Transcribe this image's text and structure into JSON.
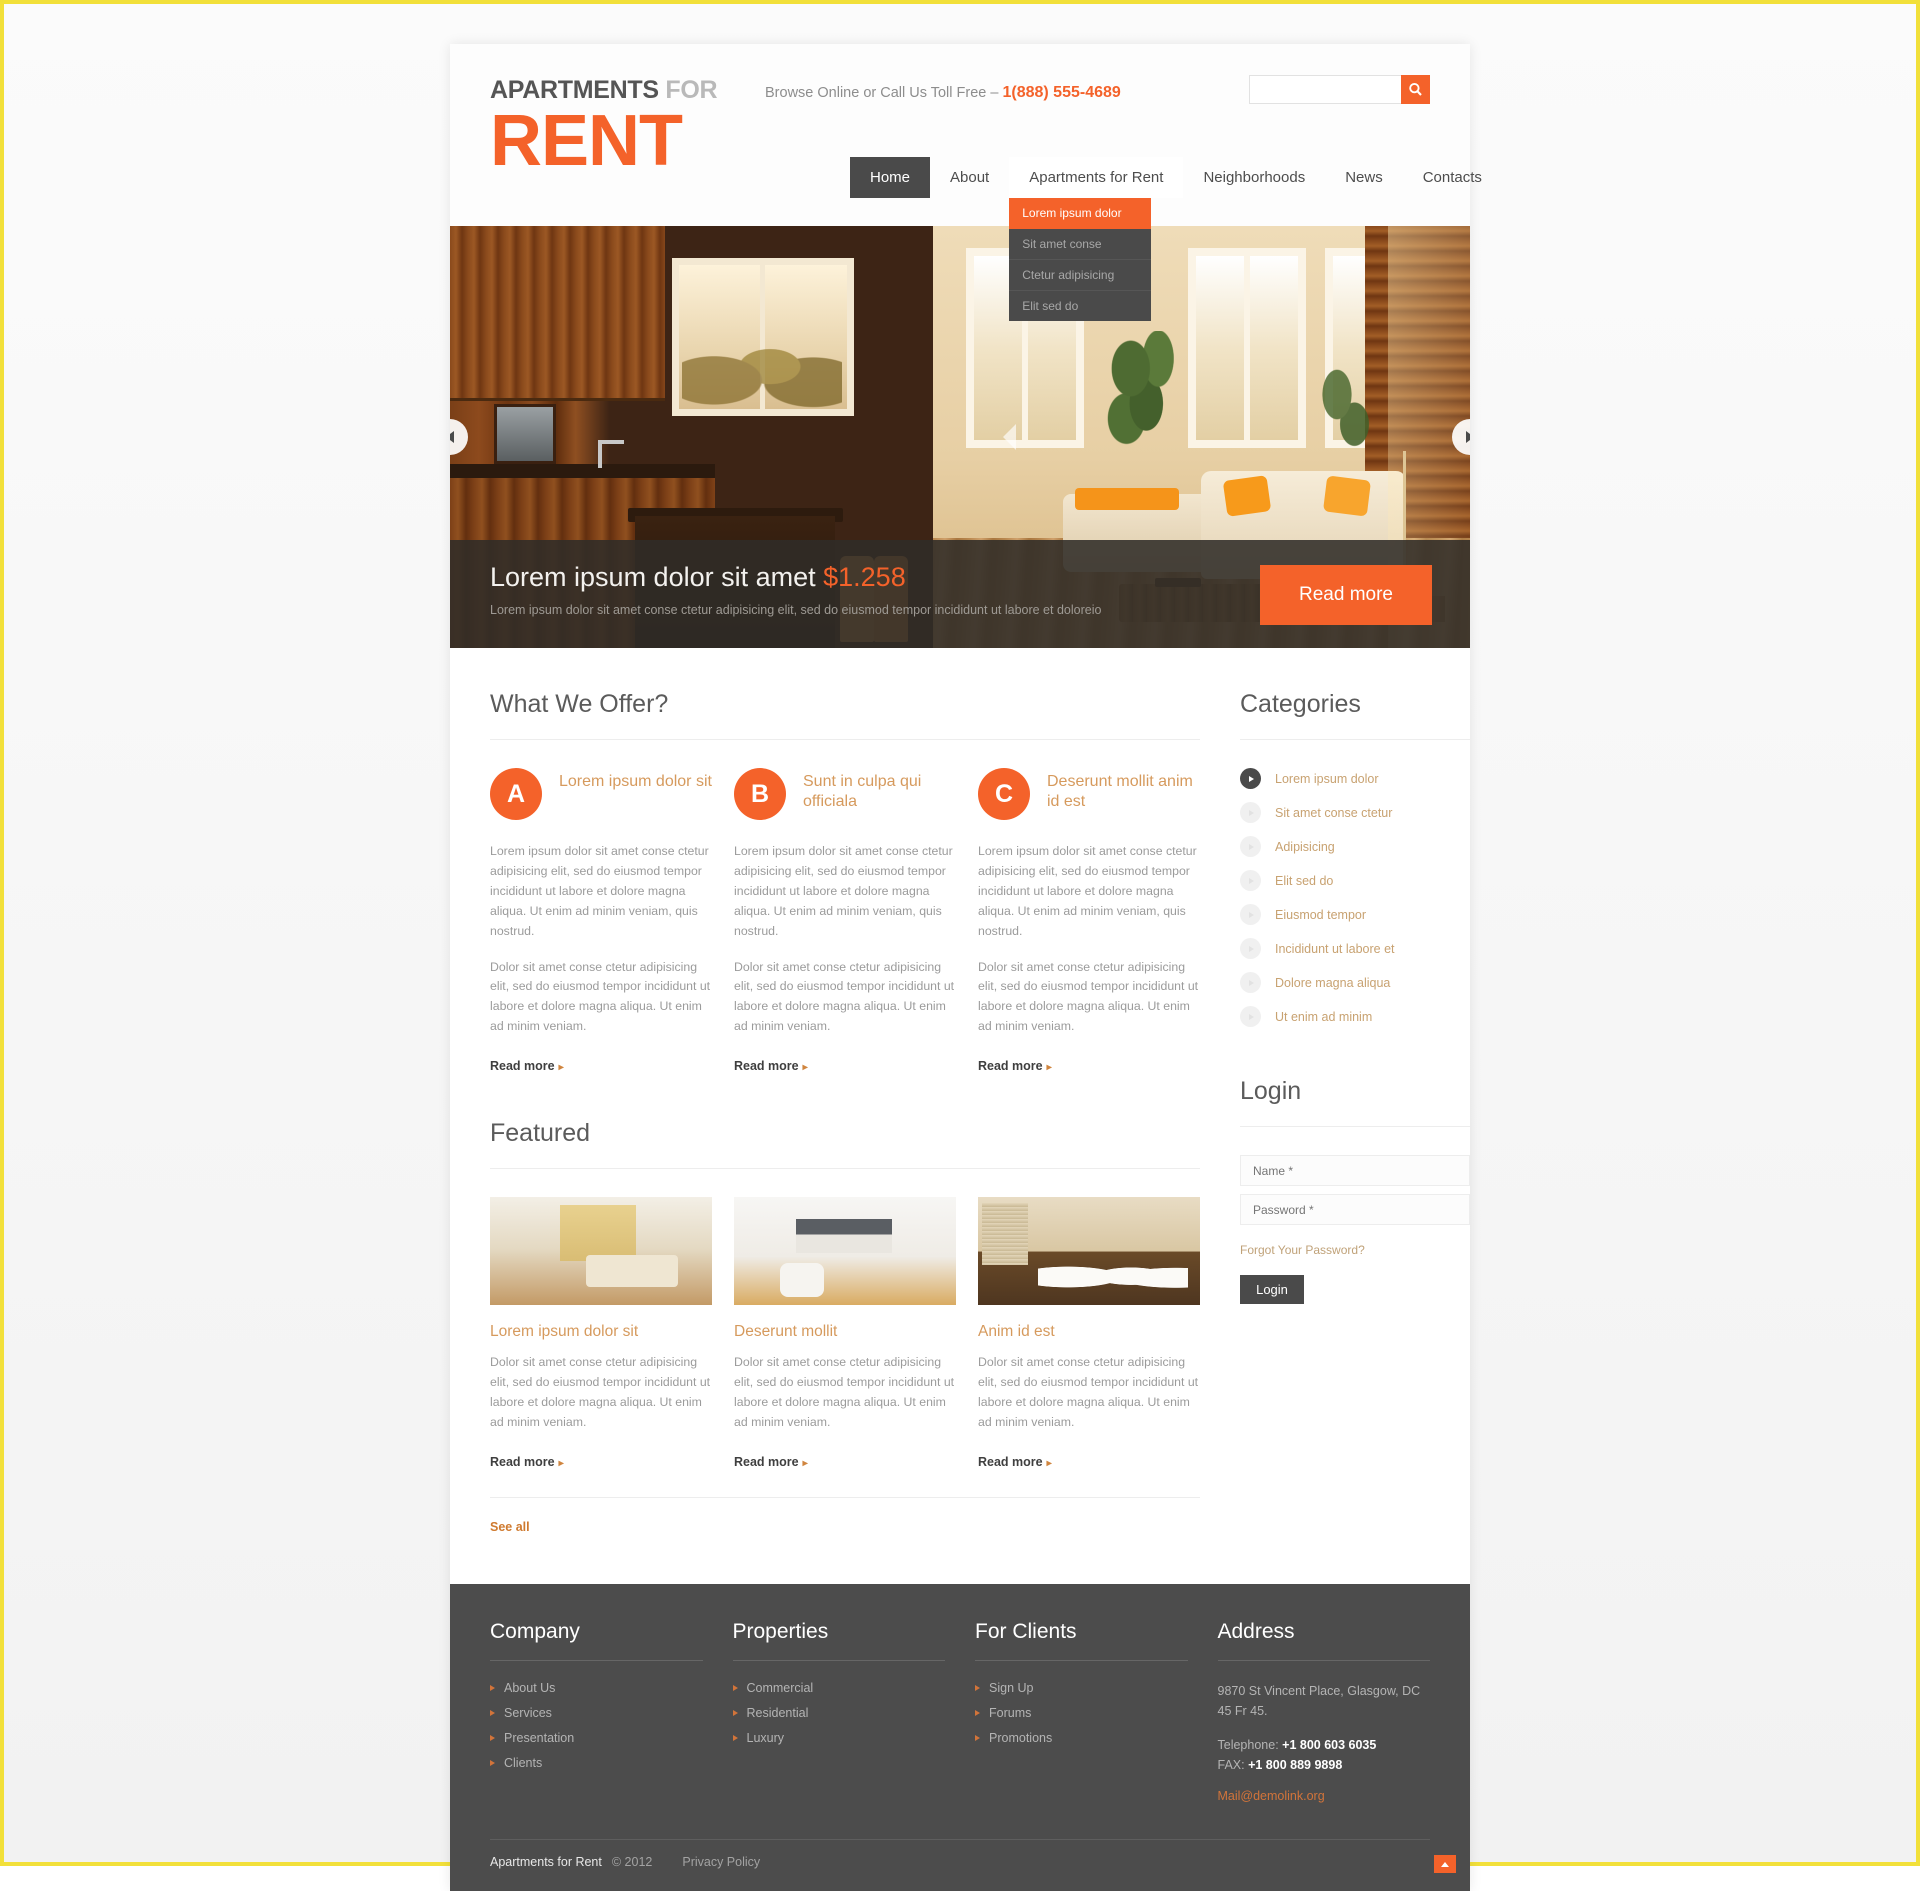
{
  "header": {
    "logo_top_bold": "APARTMENTS",
    "logo_top_light": "FOR",
    "logo_main": "RENT",
    "toll_free_text": "Browse Online or Call Us Toll Free – ",
    "phone": "1(888) 555-4689",
    "search": {
      "value": "",
      "placeholder": "",
      "icon": "search-icon"
    },
    "nav": [
      {
        "label": "Home",
        "state": "active"
      },
      {
        "label": "About",
        "state": ""
      },
      {
        "label": "Apartments for Rent",
        "state": "open"
      },
      {
        "label": "Neighborhoods",
        "state": ""
      },
      {
        "label": "News",
        "state": ""
      },
      {
        "label": "Contacts",
        "state": ""
      }
    ],
    "dropdown": [
      {
        "label": "Lorem ipsum dolor",
        "highlighted": true
      },
      {
        "label": "Sit amet conse",
        "highlighted": false
      },
      {
        "label": "Ctetur adipisicing",
        "highlighted": false
      },
      {
        "label": "Elit sed do",
        "highlighted": false
      }
    ]
  },
  "slider": {
    "prev_icon": "chevron-left-icon",
    "next_icon": "chevron-right-icon",
    "mid_icon": "chevron-right-icon",
    "caption_title": "Lorem ipsum dolor sit amet ",
    "caption_price": "$1.258",
    "caption_sub": "Lorem ipsum dolor sit amet conse ctetur adipisicing elit, sed do eiusmod tempor incididunt ut labore et doloreio",
    "read_more_label": "Read more"
  },
  "offers": {
    "section_title": "What We Offer?",
    "items": [
      {
        "badge": "A",
        "title": "Lorem ipsum dolor sit",
        "p1": "Lorem ipsum dolor sit amet conse ctetur adipisicing elit, sed do eiusmod tempor incididunt ut labore et dolore magna aliqua. Ut enim ad minim veniam, quis nostrud.",
        "p2": "Dolor sit amet conse ctetur adipisicing elit, sed do eiusmod tempor incididunt ut labore et dolore magna aliqua. Ut enim ad minim veniam.",
        "read_more": "Read more"
      },
      {
        "badge": "B",
        "title": "Sunt in culpa qui officiala",
        "p1": "Lorem ipsum dolor sit amet conse ctetur adipisicing elit, sed do eiusmod tempor incididunt ut labore et dolore magna aliqua. Ut enim ad minim veniam, quis nostrud.",
        "p2": "Dolor sit amet conse ctetur adipisicing elit, sed do eiusmod tempor incididunt ut labore et dolore magna aliqua. Ut enim ad minim veniam.",
        "read_more": "Read more"
      },
      {
        "badge": "C",
        "title": "Deserunt mollit anim id est",
        "p1": "Lorem ipsum dolor sit amet conse ctetur adipisicing elit, sed do eiusmod tempor incididunt ut labore et dolore magna aliqua. Ut enim ad minim veniam, quis nostrud.",
        "p2": "Dolor sit amet conse ctetur adipisicing elit, sed do eiusmod tempor incididunt ut labore et dolore magna aliqua. Ut enim ad minim veniam.",
        "read_more": "Read more"
      }
    ]
  },
  "featured": {
    "section_title": "Featured",
    "see_all": "See all",
    "items": [
      {
        "title": "Lorem ipsum dolor sit",
        "text": "Dolor sit amet conse ctetur adipisicing elit, sed do eiusmod tempor incididunt ut labore et dolore magna aliqua. Ut enim ad minim veniam.",
        "read_more": "Read more"
      },
      {
        "title": "Deserunt mollit",
        "text": "Dolor sit amet conse ctetur adipisicing elit, sed do eiusmod tempor incididunt ut labore et dolore magna aliqua. Ut enim ad minim veniam.",
        "read_more": "Read more"
      },
      {
        "title": "Anim id est",
        "text": "Dolor sit amet conse ctetur adipisicing elit, sed do eiusmod tempor incididunt ut labore et dolore magna aliqua. Ut enim ad minim veniam.",
        "read_more": "Read more"
      }
    ]
  },
  "sidebar": {
    "categories_title": "Categories",
    "categories": [
      {
        "label": "Lorem ipsum dolor",
        "active": true
      },
      {
        "label": "Sit amet conse ctetur",
        "active": false
      },
      {
        "label": "Adipisicing",
        "active": false
      },
      {
        "label": "Elit sed do",
        "active": false
      },
      {
        "label": "Eiusmod tempor",
        "active": false
      },
      {
        "label": "Incididunt ut labore et",
        "active": false
      },
      {
        "label": "Dolore magna aliqua",
        "active": false
      },
      {
        "label": "Ut enim ad minim",
        "active": false
      }
    ],
    "login_title": "Login",
    "name_placeholder": "Name *",
    "name_value": "",
    "password_placeholder": "Password *",
    "password_value": "",
    "forgot_label": "Forgot Your Password?",
    "login_button": "Login"
  },
  "footer": {
    "columns": [
      {
        "title": "Company",
        "links": [
          "About Us",
          "Services",
          "Presentation",
          "Clients"
        ]
      },
      {
        "title": "Properties",
        "links": [
          "Commercial",
          "Residential",
          "Luxury"
        ]
      },
      {
        "title": "For Clients",
        "links": [
          "Sign Up",
          "Forums",
          "Promotions"
        ]
      }
    ],
    "address": {
      "title": "Address",
      "street": "9870 St Vincent Place, Glasgow, DC 45 Fr 45.",
      "telephone_label": "Telephone: ",
      "telephone": "+1 800 603 6035",
      "fax_label": "FAX: ",
      "fax": "+1 800 889 9898",
      "mail": "Mail@demolink.org"
    },
    "copyright_brand": "Apartments for Rent",
    "copyright_year": "© 2012",
    "privacy": "Privacy Policy",
    "to_top_icon": "arrow-up-icon"
  },
  "colors": {
    "accent": "#f4622a",
    "dark": "#4a4a4a",
    "muted": "#9b9b9b",
    "gold": "#d69a5d"
  }
}
